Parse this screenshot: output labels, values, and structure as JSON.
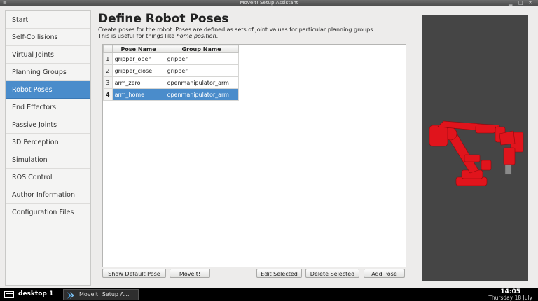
{
  "window": {
    "title": "MoveIt! Setup Assistant",
    "menu_glyph": "≡",
    "min_glyph": "▁",
    "max_glyph": "□",
    "close_glyph": "✕"
  },
  "sidebar": {
    "selected_index": 4,
    "items": [
      {
        "label": "Start"
      },
      {
        "label": "Self-Collisions"
      },
      {
        "label": "Virtual Joints"
      },
      {
        "label": "Planning Groups"
      },
      {
        "label": "Robot Poses"
      },
      {
        "label": "End Effectors"
      },
      {
        "label": "Passive Joints"
      },
      {
        "label": "3D Perception"
      },
      {
        "label": "Simulation"
      },
      {
        "label": "ROS Control"
      },
      {
        "label": "Author Information"
      },
      {
        "label": "Configuration Files"
      }
    ]
  },
  "main": {
    "title": "Define Robot Poses",
    "description_line1": "Create poses for the robot. Poses are defined as sets of joint values for particular planning groups.",
    "description_line2_prefix": "This is useful for things like ",
    "description_line2_emphasis": "home position",
    "description_line2_suffix": "."
  },
  "table": {
    "columns": [
      "Pose Name",
      "Group Name"
    ],
    "selected_row": 3,
    "rows": [
      {
        "num": "1",
        "pose": "gripper_open",
        "group": "gripper"
      },
      {
        "num": "2",
        "pose": "gripper_close",
        "group": "gripper"
      },
      {
        "num": "3",
        "pose": "arm_zero",
        "group": "openmanipulator_arm"
      },
      {
        "num": "4",
        "pose": "arm_home",
        "group": "openmanipulator_arm"
      }
    ]
  },
  "buttons": {
    "show_default": "Show Default Pose",
    "moveit": "MoveIt!",
    "edit": "Edit Selected",
    "delete": "Delete Selected",
    "add": "Add Pose"
  },
  "taskbar": {
    "desktop_label": "desktop 1",
    "task_label": "MoveIt! Setup A...",
    "time": "14:05",
    "date": "Thursday 18 July"
  },
  "colors": {
    "selection": "#4a8ccb",
    "viewport_bg": "#454545",
    "robot": "#e0141c"
  }
}
